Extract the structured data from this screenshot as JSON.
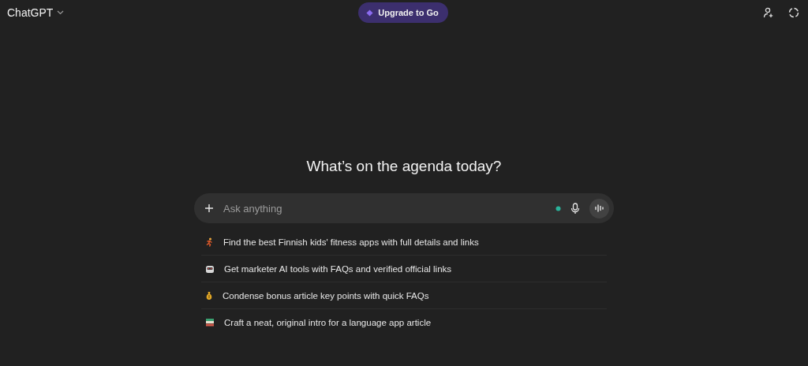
{
  "header": {
    "app_name": "ChatGPT",
    "upgrade_button": "Upgrade to Go"
  },
  "heading": "What’s on the agenda today?",
  "composer": {
    "placeholder": "Ask anything"
  },
  "suggestions": [
    {
      "kind": "runner",
      "text": "Find the best Finnish kids' fitness apps with full details and links"
    },
    {
      "kind": "robot",
      "text": "Get marketer AI tools with FAQs and verified official links"
    },
    {
      "kind": "moneybag",
      "text": "Condense bonus article key points with quick FAQs"
    },
    {
      "kind": "books",
      "text": "Craft a neat, original intro for a language app article"
    }
  ]
}
